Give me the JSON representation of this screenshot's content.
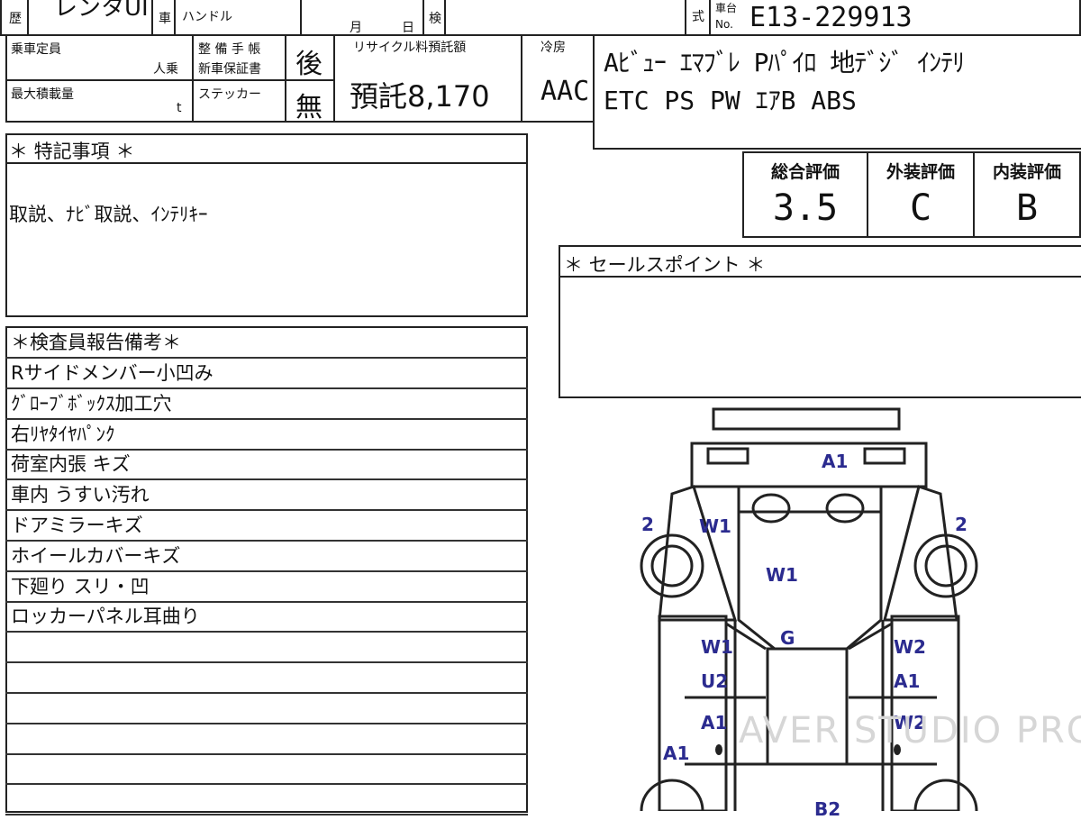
{
  "header": {
    "history_label": "歴",
    "model_value": "レンタUI",
    "car_label": "車",
    "handle_label": "ハンドル",
    "month_label": "月",
    "day_label": "日",
    "inspection_label": "検",
    "type_label": "式",
    "chassis_label_1": "車台",
    "chassis_label_2": "No.",
    "chassis_no": "E13-229913"
  },
  "info": {
    "capacity_label": "乗車定員",
    "capacity_unit": "人乗",
    "max_load_label": "最大積載量",
    "max_load_unit": "t",
    "maintenance_label": "整 備 手 帳",
    "warranty_label": "新車保証書",
    "sticker_label": "ステッカー",
    "maintenance_value": "後",
    "sticker_value": "無",
    "recycle_label": "リサイクル料預託額",
    "recycle_value": "預託8,170",
    "aircon_label": "冷房",
    "aircon_value": "AAC",
    "equipment_line1": "Aﾋﾞｭｰ ｴﾏﾌﾞﾚ Pﾊﾟｲﾛ 地ﾃﾞｼﾞ ｲﾝﾃﾘ",
    "equipment_line2": "ETC PS PW ｴｱB ABS"
  },
  "special_notes": {
    "title": "＊ 特記事項 ＊",
    "body": "取説、ﾅﾋﾞ取説、ｲﾝﾃﾘｷｰ"
  },
  "grades": {
    "overall_label": "総合評価",
    "exterior_label": "外装評価",
    "interior_label": "内装評価",
    "overall_value": "3.5",
    "exterior_value": "C",
    "interior_value": "B"
  },
  "sales_point": {
    "title": "＊ セールスポイント ＊",
    "body": ""
  },
  "inspector_report": {
    "title": "＊検査員報告備考＊",
    "items": [
      "Rサイドメンバー小凹み",
      "ｸﾞﾛｰﾌﾞﾎﾞｯｸｽ加工穴",
      "右ﾘﾔﾀｲﾔﾊﾟﾝｸ",
      "荷室内張 キズ",
      "車内 うすい汚れ",
      "ドアミラーキズ",
      "ホイールカバーキズ",
      "下廻り スリ・凹",
      "ロッカーパネル耳曲り",
      "",
      "",
      "",
      "",
      "",
      ""
    ]
  },
  "diagram": {
    "labels": [
      "A1",
      "2",
      "W1",
      "2",
      "W1",
      "W1",
      "G",
      "W2",
      "U2",
      "A1",
      "A1",
      "W2",
      "A1",
      "B2"
    ],
    "watermark": "AVER STUDIO PRO"
  }
}
